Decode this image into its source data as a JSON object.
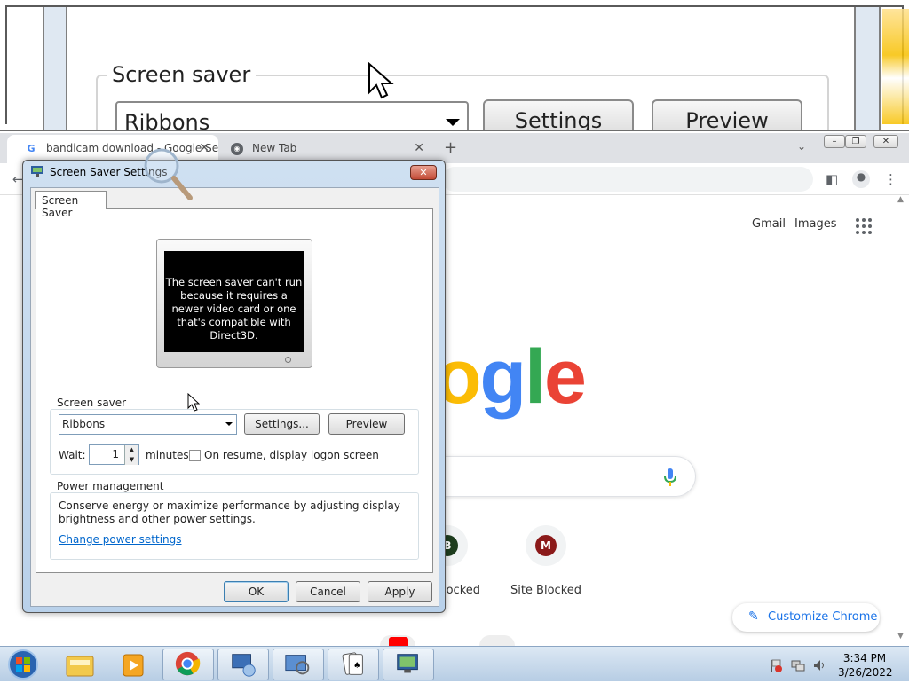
{
  "magnifier": {
    "group_label": "Screen saver",
    "combo_value": "Ribbons",
    "settings_label": "Settings",
    "preview_label": "Preview"
  },
  "chrome": {
    "tabs": [
      {
        "label": "bandicam download - Google Se"
      },
      {
        "label": "New Tab"
      }
    ],
    "header_links": {
      "gmail": "Gmail",
      "images": "Images"
    },
    "logo_text": "ogle",
    "shortcuts": [
      {
        "label": "locked",
        "initial": "B"
      },
      {
        "label": "Site Blocked",
        "initial": "M"
      }
    ],
    "customize_label": "Customize Chrome"
  },
  "dialog": {
    "title": "Screen Saver Settings",
    "tab_label": "Screen Saver",
    "preview_message": "The screen saver can't run because it requires a newer video card or one that's compatible with Direct3D.",
    "screensaver_group_label": "Screen saver",
    "selected_screensaver": "Ribbons",
    "settings_button": "Settings...",
    "preview_button": "Preview",
    "wait_label": "Wait:",
    "wait_value": "1",
    "minutes_label": "minutes",
    "logon_checkbox_label": "On resume, display logon screen",
    "logon_checked": false,
    "power_group_label": "Power management",
    "power_text_line1": "Conserve energy or maximize performance by adjusting display",
    "power_text_line2": "brightness and other power settings.",
    "power_link": "Change power settings",
    "ok_button": "OK",
    "cancel_button": "Cancel",
    "apply_button": "Apply"
  },
  "taskbar": {
    "time": "3:34 PM",
    "date": "3/26/2022"
  },
  "colors": {
    "google_blue": "#4285f4",
    "google_red": "#ea4335",
    "google_yellow": "#fbbc05",
    "google_green": "#34a853",
    "link_blue": "#0066cc",
    "chrome_accent": "#1a73e8"
  }
}
